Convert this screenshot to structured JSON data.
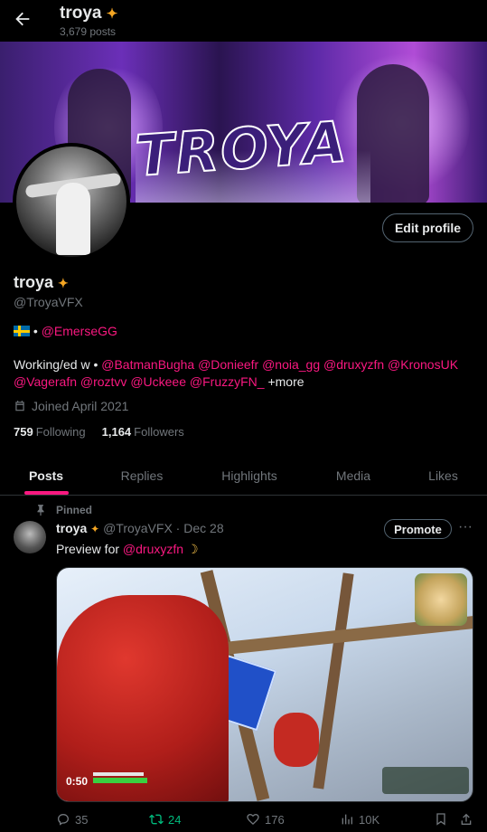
{
  "header": {
    "name": "troya",
    "posts_count": "3,679 posts"
  },
  "banner": {
    "word": "TROYA"
  },
  "profile": {
    "edit_label": "Edit profile",
    "name": "troya",
    "handle": "@TroyaVFX",
    "bio_line1_sep": " • ",
    "bio_line1_mention": "@EmerseGG",
    "bio_worked_prefix": "Working/ed w • ",
    "bio_mentions": "@BatmanBugha @Donieefr @noia_gg @druxyzfn @KronosUK @Vagerafn @roztvv @Uckeee @FruzzyFN_",
    "bio_more": " +more",
    "joined": "Joined April 2021",
    "following_count": "759",
    "following_label": "Following",
    "followers_count": "1,164",
    "followers_label": "Followers"
  },
  "tabs": [
    "Posts",
    "Replies",
    "Highlights",
    "Media",
    "Likes"
  ],
  "active_tab": "Posts",
  "post": {
    "pinned_label": "Pinned",
    "author_name": "troya",
    "author_handle": "@TroyaVFX",
    "date_sep": " · ",
    "date": "Dec 28",
    "promote_label": "Promote",
    "more_label": "···",
    "text_prefix": "Preview for ",
    "text_mention": "@druxyzfn",
    "video_time": "0:50",
    "replies": "35",
    "reposts": "24",
    "likes": "176",
    "views": "10K"
  },
  "colors": {
    "accent": "#f91880",
    "repost": "#00ba7c",
    "muted": "#71767b",
    "background": "#000000"
  },
  "icons": [
    "back-arrow-icon",
    "emoji-icon",
    "swedish-flag-icon",
    "calendar-icon",
    "pin-icon",
    "reply-icon",
    "repost-icon",
    "like-icon",
    "views-icon",
    "bookmark-icon",
    "share-icon",
    "moon-emoji-icon"
  ]
}
